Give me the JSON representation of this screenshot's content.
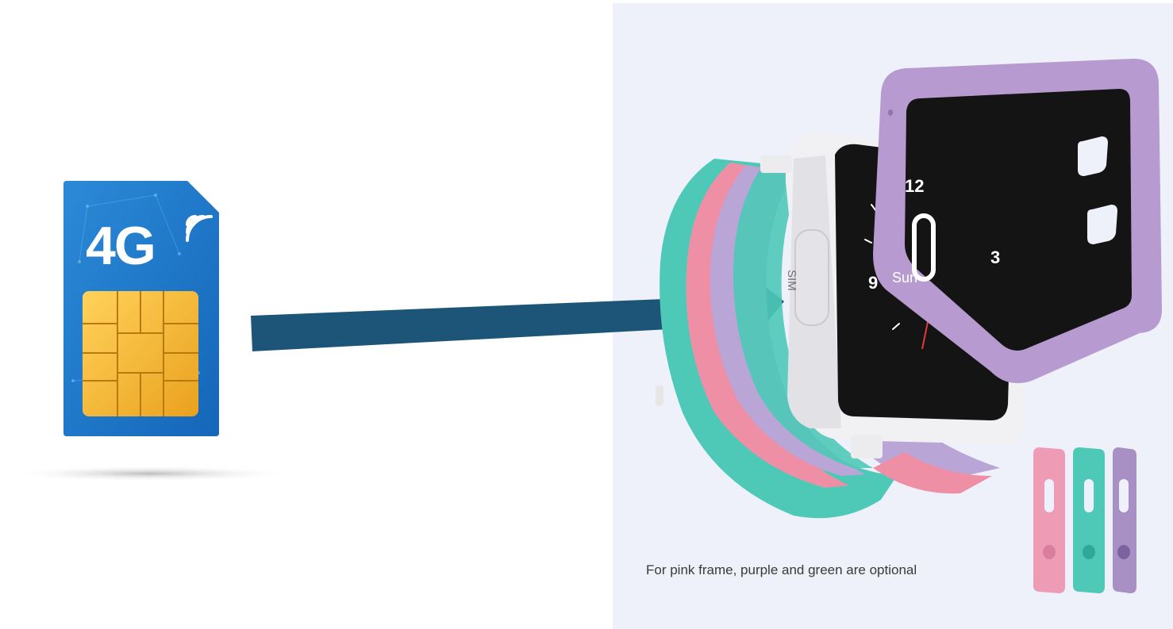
{
  "sim_card": {
    "label": "4G",
    "icon": "sim-card-icon"
  },
  "watch": {
    "sim_slot_label": "SIM",
    "dial": {
      "numerals": [
        "12",
        "3",
        "9"
      ],
      "day_label": "Sun"
    }
  },
  "caption": "For pink frame, purple and green are optional",
  "frame_colors": [
    "pink",
    "green",
    "purple"
  ],
  "colors": {
    "arrow": "#1c5577",
    "sim_blue": "#1d76c9",
    "chip_gold": "#f2b42c",
    "frame_purple": "#b79ad0",
    "band_teal": "#4ec9b8",
    "band_pink": "#ef8fa6",
    "band_lavender": "#b9a5d6"
  }
}
